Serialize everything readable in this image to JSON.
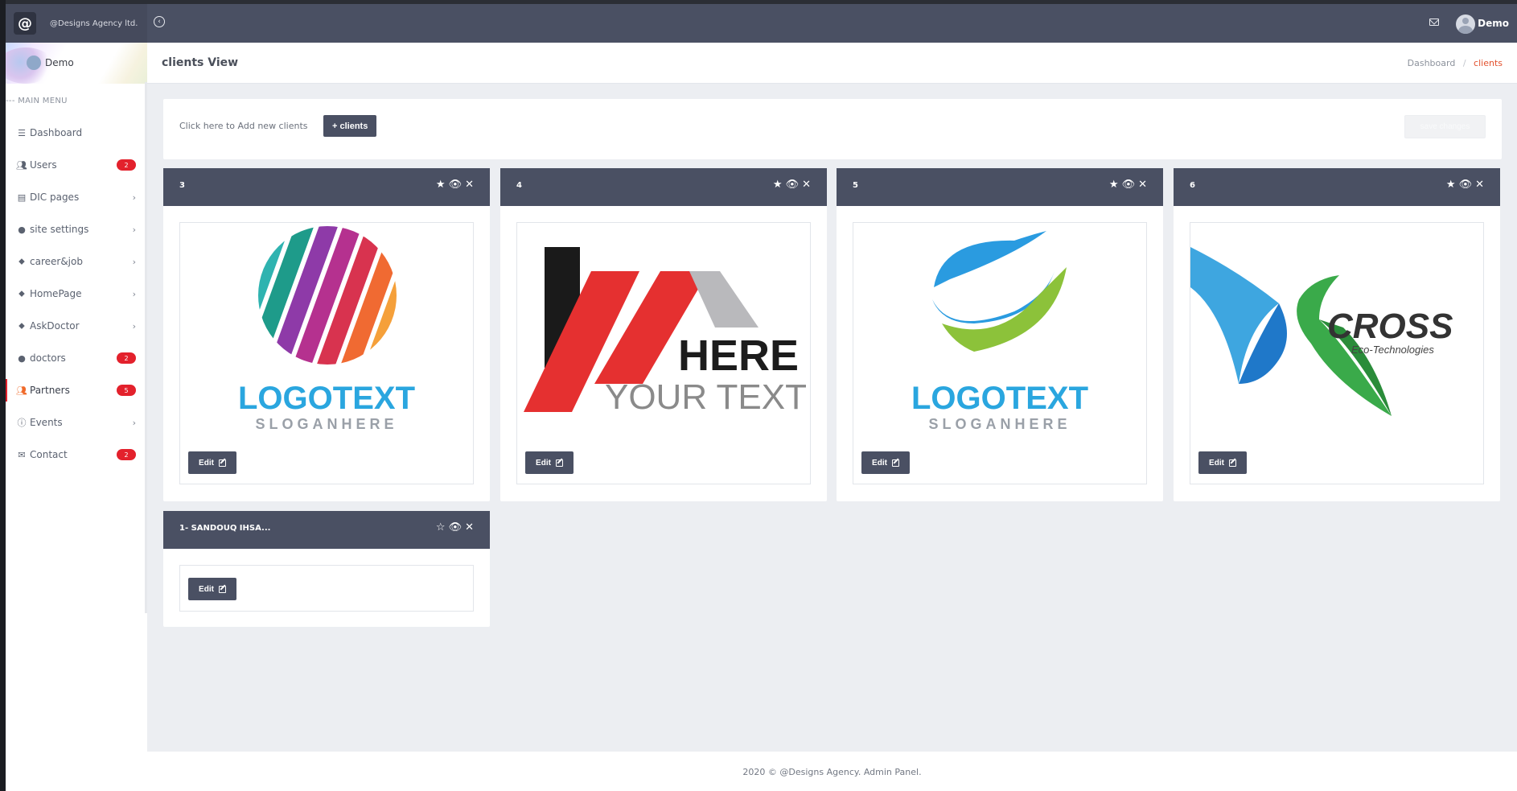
{
  "brand": {
    "name": "@Designs Agency ltd."
  },
  "sidebar": {
    "user_name": "Demo",
    "menu_title": "--- MAIN MENU",
    "items": [
      {
        "label": "Dashboard",
        "icon": "bars-icon",
        "badge": "",
        "chevron": false
      },
      {
        "label": "Users",
        "icon": "users-icon",
        "badge": "2",
        "chevron": false
      },
      {
        "label": "DIC pages",
        "icon": "pages-icon",
        "badge": "",
        "chevron": true
      },
      {
        "label": "site settings",
        "icon": "circle-icon",
        "badge": "",
        "chevron": true
      },
      {
        "label": "career&job",
        "icon": "tag-icon",
        "badge": "",
        "chevron": true
      },
      {
        "label": "HomePage",
        "icon": "tag-icon",
        "badge": "",
        "chevron": true
      },
      {
        "label": "AskDoctor",
        "icon": "tag-icon",
        "badge": "",
        "chevron": true
      },
      {
        "label": "doctors",
        "icon": "circle-icon",
        "badge": "2",
        "chevron": false
      },
      {
        "label": "Partners",
        "icon": "users-icon",
        "badge": "5",
        "chevron": false,
        "active": true
      },
      {
        "label": "Events",
        "icon": "info-icon",
        "badge": "",
        "chevron": true
      },
      {
        "label": "Contact",
        "icon": "envelope-icon",
        "badge": "2",
        "chevron": false
      }
    ]
  },
  "topbar": {
    "user_name": "Demo"
  },
  "page": {
    "title": "clients View",
    "breadcrumb": {
      "home": "Dashboard",
      "current": "clients"
    }
  },
  "toolbar": {
    "hint": "Click here to Add new clients",
    "add_label": "+ clients",
    "save_label": "save changes"
  },
  "cards": [
    {
      "id": "3",
      "starred": true,
      "edit_label": "Edit",
      "logo": "logotext-sphere"
    },
    {
      "id": "4",
      "starred": true,
      "edit_label": "Edit",
      "logo": "here-your-text"
    },
    {
      "id": "5",
      "starred": true,
      "edit_label": "Edit",
      "logo": "logotext-swoosh"
    },
    {
      "id": "6",
      "starred": true,
      "edit_label": "Edit",
      "logo": "cross-eco"
    },
    {
      "id": "1- SANDOUQ IHSA...",
      "starred": false,
      "edit_label": "Edit",
      "logo": ""
    }
  ],
  "logos": {
    "logotext": "LOGOTEXT",
    "slogan": "SLOGANHERE",
    "here": "HERE",
    "your_text": "YOUR TEXT",
    "cross": "CROSS",
    "cross_sub": "Eco-Technologies"
  },
  "footer": {
    "text": "2020 © @Designs Agency. Admin Panel."
  },
  "colors": {
    "header": "#4a5063",
    "badge": "#e3212c",
    "accent": "#e3512e"
  }
}
